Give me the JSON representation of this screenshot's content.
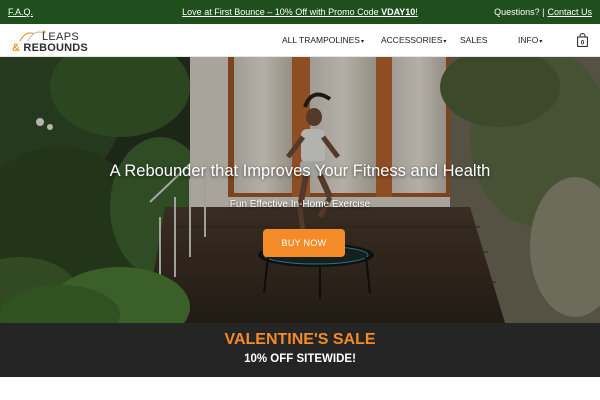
{
  "topbar": {
    "faq": "F.A.Q.",
    "promo_prefix": "Love at First Bounce – 10% Off with Promo Code ",
    "promo_code": "VDAY10",
    "promo_suffix": "!",
    "questions": "Questions? |",
    "contact": "Contact Us"
  },
  "logo": {
    "line1": "LEAPS",
    "amp": "&",
    "line2": "REBOUNDS"
  },
  "nav": {
    "items": [
      {
        "label": "ALL TRAMPOLINES",
        "dropdown": "▾"
      },
      {
        "label": "ACCESSORIES",
        "dropdown": "▾"
      },
      {
        "label": "SALES",
        "dropdown": ""
      },
      {
        "label": "INFO",
        "dropdown": "▾"
      }
    ],
    "cart_count": "0",
    "cart_icon": "shopping-bag-icon"
  },
  "hero": {
    "title": "A Rebounder that Improves Your Fitness and Health",
    "subtitle": "Fun Effective In-Home Exercise",
    "button": "BUY NOW"
  },
  "sale": {
    "title": "VALENTINE'S SALE",
    "subtitle": "10% OFF SITEWIDE!"
  },
  "colors": {
    "topbar": "#1e4f1d",
    "accent": "#f58a29",
    "sale_bg": "#121212"
  }
}
